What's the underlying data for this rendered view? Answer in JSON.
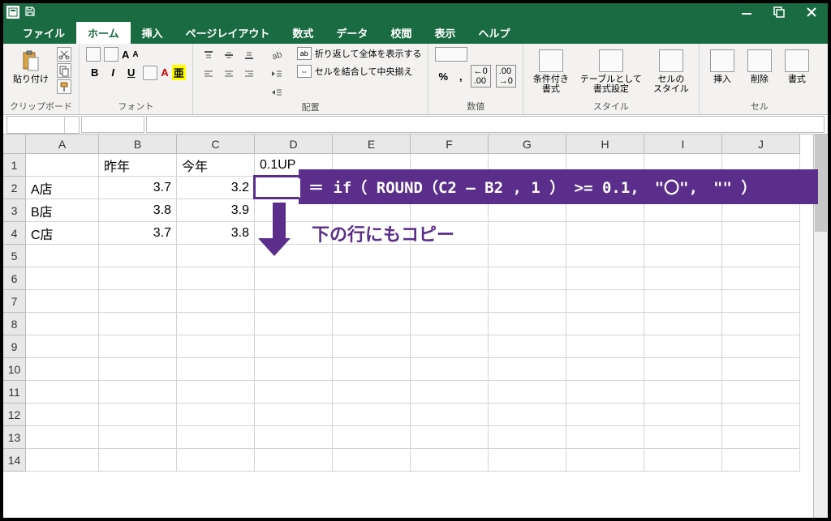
{
  "tabs": {
    "file": "ファイル",
    "home": "ホーム",
    "insert": "挿入",
    "layout": "ページレイアウト",
    "formulas": "数式",
    "data": "データ",
    "review": "校閲",
    "view": "表示",
    "help": "ヘルプ"
  },
  "groups": {
    "clipboard": "クリップボード",
    "paste": "貼り付け",
    "font": "フォント",
    "alignment": "配置",
    "number": "数値",
    "styles": "スタイル",
    "cond": "条件付き\n書式",
    "tablefmt": "テーブルとして\n書式設定",
    "cellstyle": "セルの\nスタイル",
    "cells": "セル",
    "ins": "挿入",
    "del": "削除",
    "fmt": "書式",
    "wrap": "折り返して全体を表示する",
    "merge": "セルを結合して中央揃え"
  },
  "cols": [
    "A",
    "B",
    "C",
    "D",
    "E",
    "F",
    "G",
    "H",
    "I",
    "J"
  ],
  "rows": [
    "1",
    "2",
    "3",
    "4",
    "5",
    "6",
    "7",
    "8",
    "9",
    "10",
    "11",
    "12",
    "13",
    "14"
  ],
  "cells": {
    "B1": "昨年",
    "C1": "今年",
    "D1": "0.1UP",
    "A2": "A店",
    "B2": "3.7",
    "C2": "3.2",
    "A3": "B店",
    "B3": "3.8",
    "C3": "3.9",
    "A4": "C店",
    "B4": "3.7",
    "C4": "3.8"
  },
  "annotations": {
    "formula": "＝ if（ ROUND（C2 – B2 , 1 ） >= 0.1,　\"〇\",　\"\" ）",
    "copy_down": "下の行にもコピー"
  }
}
